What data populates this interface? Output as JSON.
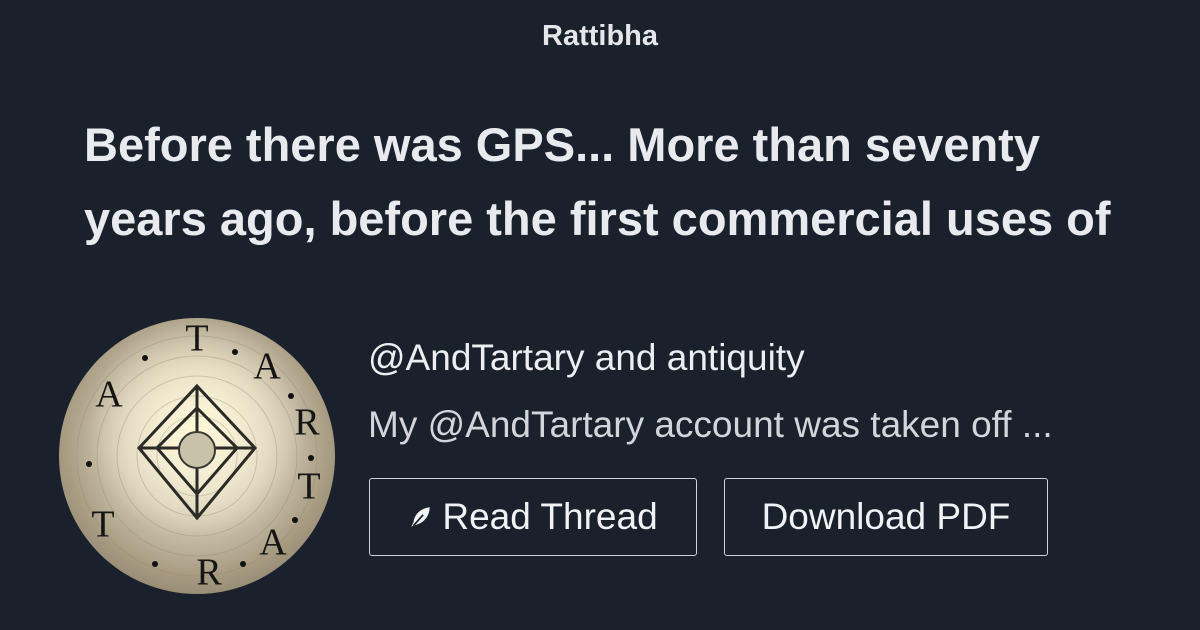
{
  "site": {
    "name": "Rattibha"
  },
  "thread": {
    "title": "Before there was GPS... More than seventy years ago, before the first commercial uses of",
    "author": "@AndTartary and antiquity",
    "description": "My @AndTartary account was taken off ..."
  },
  "actions": {
    "read_label": "Read Thread",
    "download_label": "Download PDF"
  },
  "avatar": {
    "letters": [
      "T",
      "A",
      "R",
      "T",
      "A",
      "R",
      "T",
      "A"
    ]
  }
}
